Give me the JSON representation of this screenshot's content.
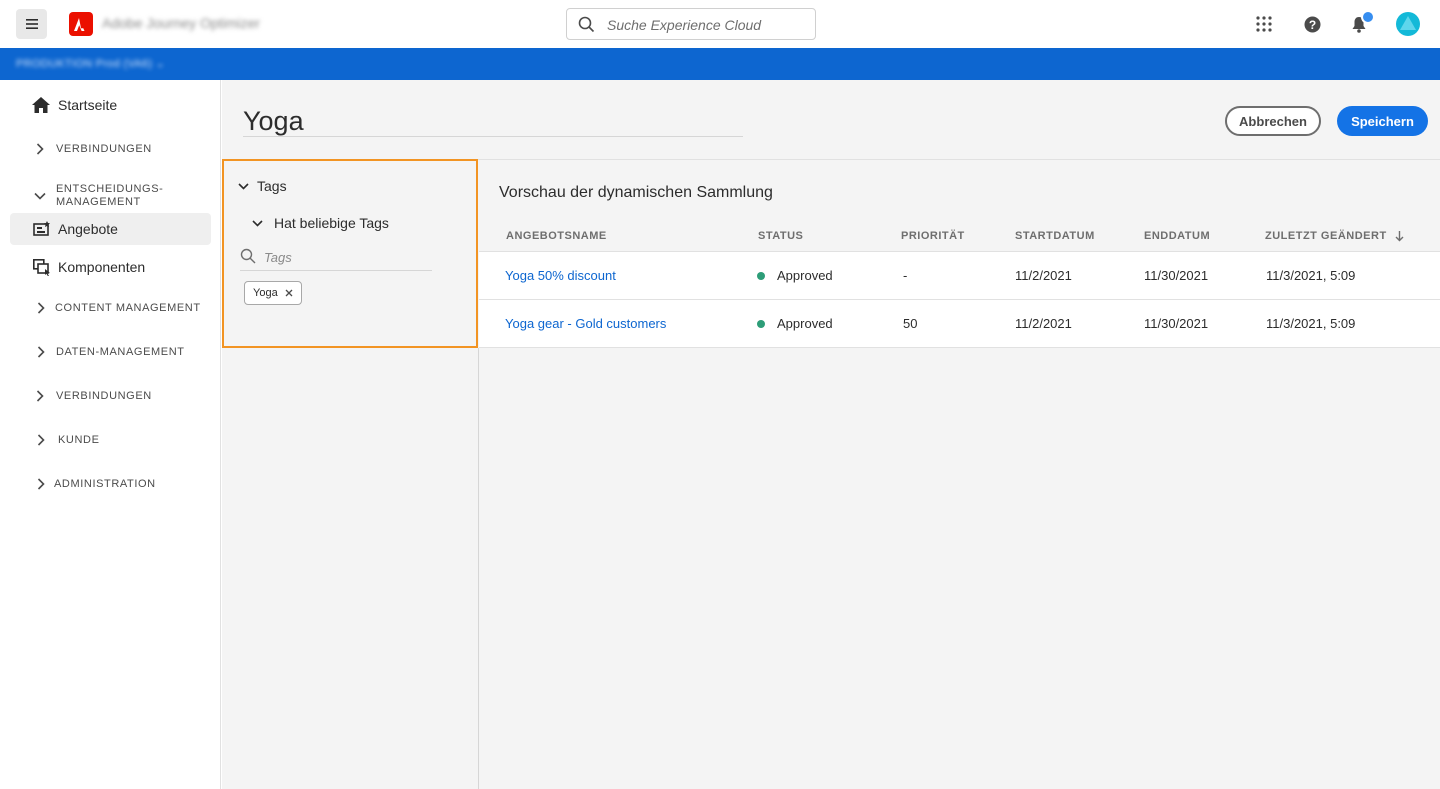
{
  "header": {
    "app_name": "Adobe Journey Optimizer",
    "search_placeholder": "Suche Experience Cloud",
    "icons": [
      "menu-icon",
      "adobe-logo-icon",
      "search-icon",
      "apps-grid-icon",
      "help-icon",
      "bell-icon",
      "avatar"
    ]
  },
  "org_bar": {
    "text": "PRODUKTION Prod (VA6)"
  },
  "sidebar": {
    "items": [
      {
        "label": "Startseite",
        "icon": "home-icon"
      },
      {
        "label": "VERBINDUNGEN",
        "icon": "chevron-right-icon"
      },
      {
        "label": "ENTSCHEIDUNGS-",
        "label2": "MANAGEMENT",
        "icon": "chevron-down-icon"
      },
      {
        "label": "Angebote",
        "icon": "offers-icon",
        "active": true
      },
      {
        "label": "Komponenten",
        "icon": "components-icon"
      },
      {
        "label": "CONTENT MANAGEMENT",
        "icon": "chevron-right-icon"
      },
      {
        "label": "DATEN-MANAGEMENT",
        "icon": "chevron-right-icon"
      },
      {
        "label": "VERBINDUNGEN",
        "icon": "chevron-right-icon"
      },
      {
        "label": "KUNDE",
        "icon": "chevron-right-icon"
      },
      {
        "label": "ADMINISTRATION",
        "icon": "chevron-right-icon"
      }
    ]
  },
  "main": {
    "title": "Yoga",
    "cancel_label": "Abbrechen",
    "save_label": "Speichern"
  },
  "tags_panel": {
    "section_label": "Tags",
    "condition_label": "Hat beliebige Tags",
    "search_placeholder": "Tags",
    "chips": [
      "Yoga"
    ]
  },
  "preview": {
    "title": "Vorschau der dynamischen Sammlung",
    "columns": [
      "ANGEBOTSNAME",
      "STATUS",
      "PRIORITÄT",
      "STARTDATUM",
      "ENDDATUM",
      "ZULETZT GEÄNDERT"
    ],
    "rows": [
      {
        "name": "Yoga 50% discount",
        "status": "Approved",
        "priority": "-",
        "start": "11/2/2021",
        "end": "11/30/2021",
        "modified": "11/3/2021, 5:09"
      },
      {
        "name": "Yoga gear - Gold customers",
        "status": "Approved",
        "priority": "50",
        "start": "11/2/2021",
        "end": "11/30/2021",
        "modified": "11/3/2021, 5:09"
      }
    ],
    "status_color": "#2d9d78"
  },
  "colors": {
    "brand_blue": "#0d66d0",
    "cta_blue": "#1473e6",
    "highlight_orange": "#f29423",
    "adobe_red": "#eb1000"
  }
}
